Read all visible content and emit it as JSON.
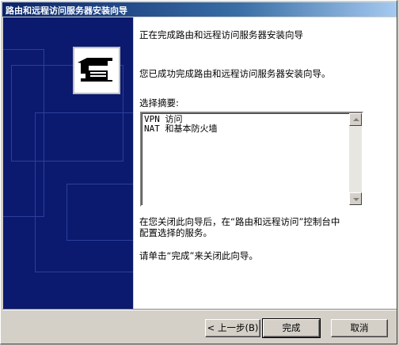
{
  "window": {
    "title": "路由和远程访问服务器安装向导"
  },
  "banner": {
    "icon": "network-wizard-icon",
    "color": "#0b1a6e"
  },
  "content": {
    "heading": "正在完成路由和远程访问服务器安装向导",
    "paragraph1": "您已成功完成路由和远程访问服务器安装向导。",
    "summary_label": "选择摘要:",
    "summary_items": [
      "VPN 访问",
      "NAT 和基本防火墙"
    ],
    "paragraph2_line1": "在您关闭此向导后，在“路由和远程访问”控制台中",
    "paragraph2_line2": "配置选择的服务。",
    "paragraph3": "请单击“完成”来关闭此向导。"
  },
  "buttons": {
    "back": "< 上一步(B)",
    "finish": "完成",
    "cancel": "取消"
  }
}
